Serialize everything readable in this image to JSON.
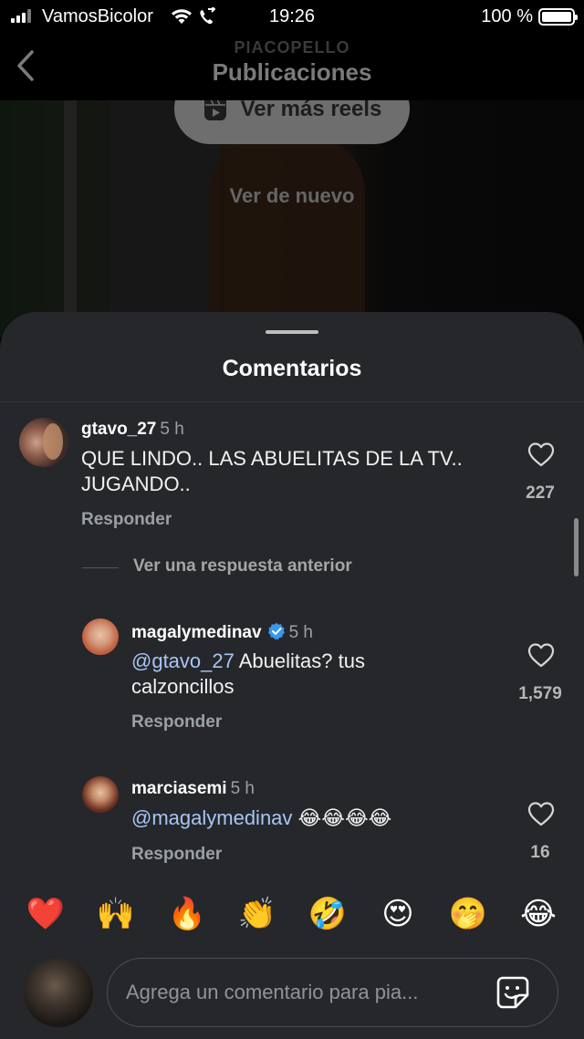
{
  "status_bar": {
    "carrier": "VamosBicolor",
    "time": "19:26",
    "battery": "100 %"
  },
  "header": {
    "subtitle": "PIACOPELLO",
    "title": "Publicaciones"
  },
  "video": {
    "reels_button": "Ver más reels",
    "replay": "Ver de nuevo"
  },
  "sheet": {
    "title": "Comentarios"
  },
  "comments": [
    {
      "user": "gtavo_27",
      "time": "5 h",
      "text": "QUE LINDO.. LAS ABUELITAS DE LA TV.. JUGANDO..",
      "likes": "227",
      "reply": "Responder"
    },
    {
      "user": "magalymedinav",
      "time": "5 h",
      "mention": "@gtavo_27",
      "text": " Abuelitas? tus calzoncillos",
      "likes": "1,579",
      "reply": "Responder"
    },
    {
      "user": "marciasemi",
      "time": "5 h",
      "mention": "@magalymedinav",
      "text": " 😂😂😂😂",
      "likes": "16",
      "reply": "Responder"
    }
  ],
  "view_previous": "Ver una respuesta anterior",
  "emojis": [
    "❤️",
    "🙌",
    "🔥",
    "👏",
    "🤣",
    "😍",
    "🤭",
    "😂"
  ],
  "composer": {
    "placeholder": "Agrega un comentario para pia..."
  }
}
